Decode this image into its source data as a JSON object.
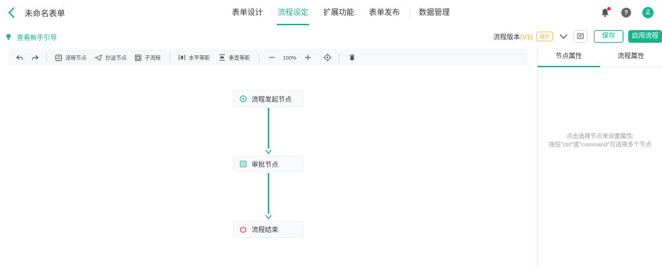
{
  "header": {
    "form_title": "未命名表单",
    "tabs": [
      {
        "label": "表单设计",
        "active": false
      },
      {
        "label": "流程设定",
        "active": true
      },
      {
        "label": "扩展功能",
        "active": false
      },
      {
        "label": "表单发布",
        "active": false
      },
      {
        "label": "数据管理",
        "active": false
      }
    ],
    "avatar_text": "孟",
    "help_text": "?"
  },
  "subbar": {
    "guide_link": "查看新手引导",
    "version_label": "流程版本",
    "version_num": "(V1)",
    "version_badge": "设计",
    "save_label": "保存",
    "enable_label": "启用流程"
  },
  "toolbar": {
    "process_node": "流程节点",
    "cc_node": "抄送节点",
    "subprocess": "子流程",
    "h_spacing": "水平等距",
    "v_spacing": "垂直等距",
    "zoom": "100%"
  },
  "flow": {
    "nodes": [
      {
        "label": "流程发起节点",
        "icon": "play-circle-icon"
      },
      {
        "label": "审批节点",
        "icon": "approval-icon"
      },
      {
        "label": "流程结束",
        "icon": "power-icon"
      }
    ]
  },
  "panel": {
    "tabs": [
      {
        "label": "节点属性",
        "active": true
      },
      {
        "label": "流程属性",
        "active": false
      }
    ],
    "hint_line1": "点击选择节点来设置属性;",
    "hint_line2": "按住\"ctrl\"或\"command\"可选择多个节点"
  },
  "colors": {
    "accent": "#14b48c",
    "version": "#f5a623",
    "danger": "#f5222d"
  }
}
